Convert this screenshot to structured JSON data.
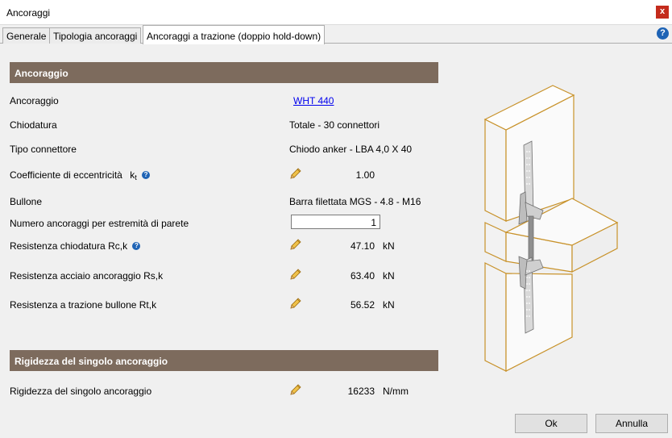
{
  "window": {
    "title": "Ancoraggi",
    "close_glyph": "x"
  },
  "tabs": [
    {
      "label": "Generale"
    },
    {
      "label": "Tipologia ancoraggi"
    },
    {
      "label": "Ancoraggi a trazione (doppio hold-down)"
    }
  ],
  "active_tab": 2,
  "help_glyph": "?",
  "sections": {
    "anchor": {
      "title": "Ancoraggio",
      "rows": {
        "anchor": {
          "label": "Ancoraggio",
          "value": "WHT 440"
        },
        "nailing": {
          "label": "Chiodatura",
          "value": "Totale - 30 connettori"
        },
        "connector_type": {
          "label": "Tipo connettore",
          "value": "Chiodo anker - LBA 4,0 X 40"
        },
        "eccentricity": {
          "label": "Coefficiente di eccentricità",
          "symbol": "k",
          "symbol_sub": "t",
          "value": "1.00"
        },
        "bolt": {
          "label": "Bullone",
          "value": "Barra filettata MGS - 4.8 - M16"
        },
        "anchors_per_end": {
          "label": "Numero ancoraggi per estremità di parete",
          "value": "1"
        },
        "nail_resistance": {
          "label": "Resistenza chiodatura Rc,k",
          "value": "47.10",
          "unit": "kN"
        },
        "steel_resistance": {
          "label": "Resistenza acciaio ancoraggio Rs,k",
          "value": "63.40",
          "unit": "kN"
        },
        "bolt_resistance": {
          "label": "Resistenza a trazione bullone Rt,k",
          "value": "56.52",
          "unit": "kN"
        }
      }
    },
    "stiffness": {
      "title": "Rigidezza del singolo ancoraggio",
      "rows": {
        "stiffness": {
          "label": "Rigidezza del singolo ancoraggio",
          "value": "16233",
          "unit": "N/mm"
        }
      }
    }
  },
  "buttons": {
    "ok": "Ok",
    "cancel": "Annulla"
  },
  "icons": {
    "edit": "pencil-icon",
    "help": "help-icon",
    "close": "close-icon"
  },
  "colors": {
    "section_header": "#7d6b5d",
    "drawing_outline": "#c8922a",
    "help": "#1e63b5"
  }
}
